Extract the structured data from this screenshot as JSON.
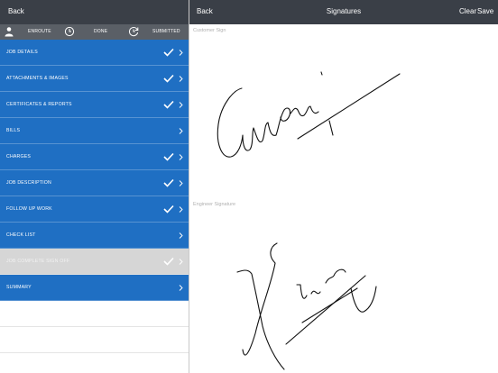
{
  "left_nav": {
    "back_label": "Back"
  },
  "status": [
    {
      "label": "ENROUTE",
      "icon": "person-icon"
    },
    {
      "label": "DONE",
      "icon": "clock-icon"
    },
    {
      "label": "SUBMITTED",
      "icon": "clock-refresh-icon"
    }
  ],
  "menu": [
    {
      "label": "JOB DETAILS",
      "checked": true
    },
    {
      "label": "ATTACHMENTS & IMAGES",
      "checked": true
    },
    {
      "label": "CERTIFICATES & REPORTS",
      "checked": true
    },
    {
      "label": "BILLS",
      "checked": false
    },
    {
      "label": "CHARGES",
      "checked": true
    },
    {
      "label": "JOB DESCRIPTION",
      "checked": true
    },
    {
      "label": "FOLLOW UP WORK",
      "checked": true
    },
    {
      "label": "CHECK LIST",
      "checked": false
    },
    {
      "label": "JOB COMPLETE SIGN OFF",
      "checked": true,
      "selected": true
    },
    {
      "label": "SUMMARY",
      "checked": false
    }
  ],
  "right_nav": {
    "back_label": "Back",
    "title": "Signatures",
    "clear_label": "Clear",
    "save_label": "Save"
  },
  "signatures": {
    "customer_label": "Customer Sign",
    "engineer_label": "Engineer Signature"
  },
  "colors": {
    "navbar": "#3a3f47",
    "menu_blue": "#1f6fc3",
    "selected_row": "#d6d6d6"
  }
}
